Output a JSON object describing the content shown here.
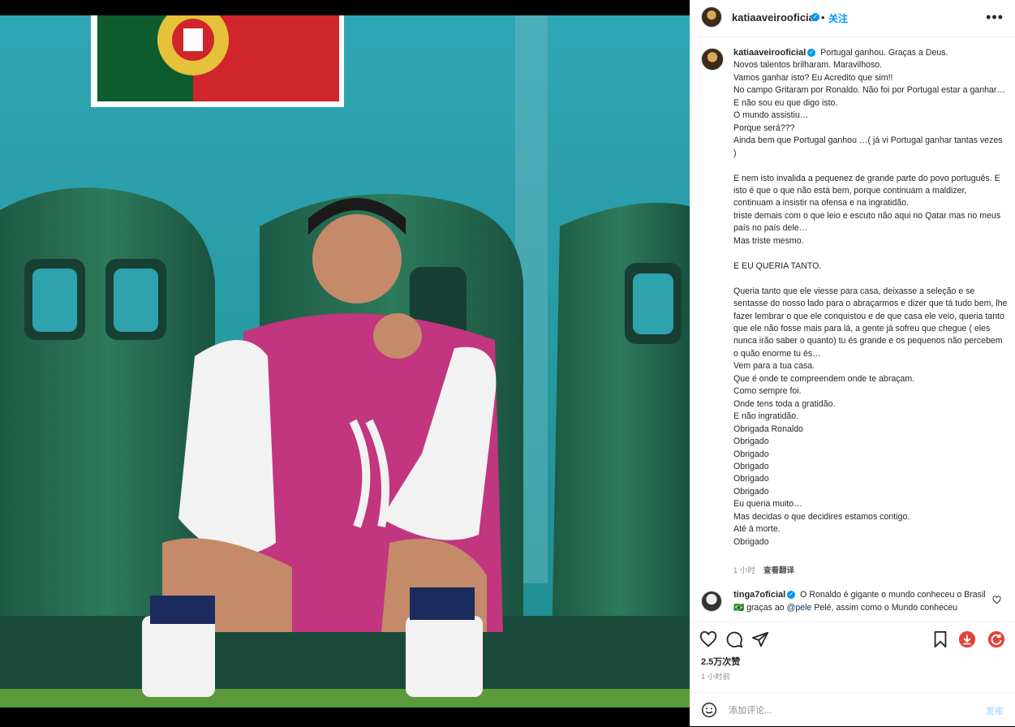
{
  "post": {
    "username": "katiaaveirooficial",
    "header_dot": "•",
    "follow_label": "关注",
    "more_label": "•••",
    "caption_lines": [
      "Portugal ganhou. Graças a Deus.",
      "Novos talentos brilharam. Maravilhoso.",
      "Vamos ganhar isto? Eu Acredito que sim!!",
      "No campo Gritaram por Ronaldo. Não foi por Portugal estar a ganhar…",
      "E não sou eu que digo isto.",
      "O mundo assistiu…",
      "Porque será???",
      "Ainda bem que Portugal ganhou …( já vi Portugal ganhar tantas vezes )",
      "",
      "E nem isto invalida a pequenez de grande parte do povo português. E isto é que o que não está bem, porque continuam a maldizer, continuam a insistir na ofensa e na ingratidão.",
      "triste demais com o que leio e escuto não aqui no Qatar mas no meus país no país dele…",
      "Mas triste mesmo.",
      "",
      "E EU QUERIA TANTO.",
      "",
      "Queria tanto que ele viesse para casa, deixasse a seleção e se sentasse do nosso lado para o abraçarmos e dizer que tá tudo bem, lhe fazer lembrar o que ele conquistou e de que casa ele veio, queria tanto que ele não fosse mais para lá, a gente já sofreu que chegue ( eles nunca irão saber o quanto) tu és grande e os pequenos não percebem o quão enorme tu és…",
      "Vem para a tua casa.",
      "Que é onde te compreendem onde te abraçam.",
      "Como sempre foi.",
      "Onde tens toda a gratidão.",
      "E não ingratidão.",
      "Obrigada Ronaldo",
      "Obrigado",
      "Obrigado",
      "Obrigado",
      "Obrigado",
      "Obrigado",
      "Eu queria muito…",
      "Mas decidas o que decidires estamos contigo.",
      "Até à morte.",
      "Obrigado"
    ],
    "caption_time": "1 小时",
    "translate_label": "查看翻译",
    "likes": "2.5万次赞",
    "post_time": "1 小时前",
    "comment_placeholder": "添加评论...",
    "post_button": "发布"
  },
  "comment": {
    "username": "tinga7oficial",
    "text_before": "O Ronaldo é gigante o mundo conheceu o Brasil 🇧🇷 graças ao ",
    "mention": "@pele",
    "text_after": " Pelé, assim como o Mundo conheceu"
  },
  "icons": {
    "like": "heart-icon",
    "comment": "comment-icon",
    "share": "share-icon",
    "save": "bookmark-icon",
    "download": "download-icon",
    "refresh": "refresh-icon",
    "emoji": "emoji-icon",
    "verified": "verified-badge-icon"
  },
  "colors": {
    "accent": "#0095f6",
    "download_red": "#e0433a"
  }
}
